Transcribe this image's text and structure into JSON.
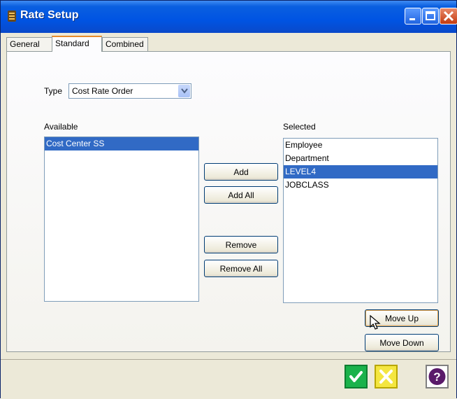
{
  "window": {
    "title": "Rate Setup"
  },
  "tabs": [
    "General",
    "Standard",
    "Combined"
  ],
  "type_field": {
    "label": "Type",
    "value": "Cost Rate Order"
  },
  "available": {
    "label": "Available",
    "items": [
      "Cost Center SS"
    ],
    "selected_index": 0
  },
  "selected": {
    "label": "Selected",
    "items": [
      "Employee",
      "Department",
      "LEVEL4",
      "JOBCLASS"
    ],
    "selected_index": 2
  },
  "buttons": {
    "add": "Add",
    "add_all": "Add All",
    "remove": "Remove",
    "remove_all": "Remove All",
    "move_up": "Move Up",
    "move_down": "Move Down"
  },
  "colors": {
    "title_bar": "#0054e3",
    "selection": "#316ac5",
    "ok": "#1bb24b",
    "cancel": "#f4e640",
    "help": "#5a1a6a"
  },
  "icons": {
    "window": "app-icon",
    "ok": "check-icon",
    "cancel": "x-icon",
    "help": "question-icon"
  }
}
